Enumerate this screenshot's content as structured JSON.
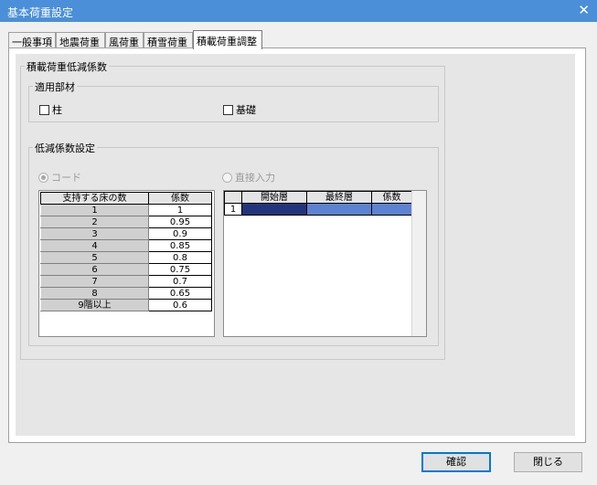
{
  "window": {
    "title": "基本荷重設定",
    "close_glyph": "✕"
  },
  "tabs": [
    {
      "label": "一般事項"
    },
    {
      "label": "地震荷重"
    },
    {
      "label": "風荷重"
    },
    {
      "label": "積雪荷重"
    },
    {
      "label": "積載荷重調整"
    }
  ],
  "active_tab": "積載荷重調整",
  "reduction": {
    "title": "積載荷重低減係数",
    "members": {
      "title": "適用部材",
      "column_label": "柱",
      "column_checked": false,
      "foundation_label": "基礎",
      "foundation_checked": false
    },
    "coef": {
      "title": "低減係数設定",
      "mode_code_label": "コード",
      "mode_code_selected": true,
      "mode_direct_label": "直接入力",
      "mode_direct_selected": false,
      "code_table": {
        "headers": [
          "支持する床の数",
          "係数"
        ],
        "rows": [
          [
            "1",
            "1"
          ],
          [
            "2",
            "0.95"
          ],
          [
            "3",
            "0.9"
          ],
          [
            "4",
            "0.85"
          ],
          [
            "5",
            "0.8"
          ],
          [
            "6",
            "0.75"
          ],
          [
            "7",
            "0.7"
          ],
          [
            "8",
            "0.65"
          ],
          [
            "9階以上",
            "0.6"
          ]
        ]
      },
      "direct_table": {
        "headers": [
          "",
          "開始層",
          "最終層",
          "係数"
        ],
        "rows": [
          [
            "1",
            "",
            "",
            ""
          ]
        ]
      }
    }
  },
  "buttons": {
    "ok": "確認",
    "close": "閉じる"
  },
  "colors": {
    "titlebar": "#4a8fd8",
    "cell_selected_dark": "#23357a",
    "cell_selected": "#5c83d1",
    "default_button_border": "#0078d7"
  }
}
